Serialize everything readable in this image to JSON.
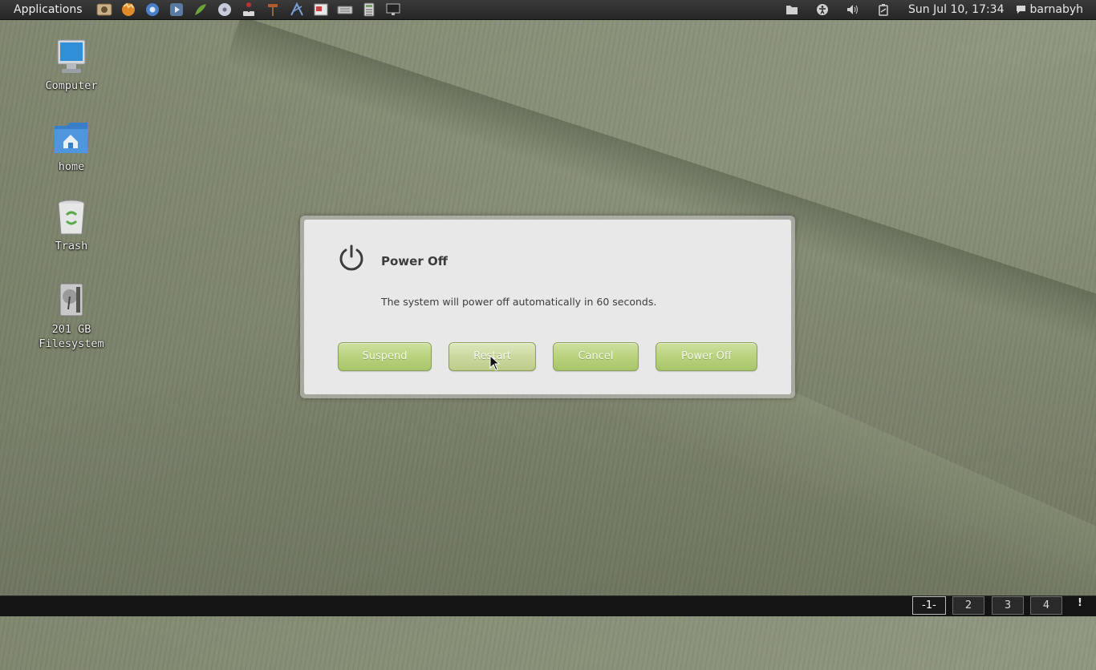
{
  "top_panel": {
    "applications_label": "Applications",
    "launchers": [
      "image-viewer-icon",
      "firefox-icon",
      "chromium-icon",
      "media-player-icon",
      "inkscape-icon",
      "disc-burner-icon",
      "joystick-icon",
      "hammer-tool-icon",
      "geogebra-icon",
      "presentation-icon",
      "keyboard-icon",
      "calculator-icon",
      "monitor-icon"
    ],
    "tray": [
      "files-icon",
      "accessibility-icon",
      "volume-icon",
      "battery-icon"
    ],
    "clock": "Sun Jul 10, 17:34",
    "user": "barnabyh"
  },
  "desktop": {
    "icons": [
      {
        "name": "computer-icon",
        "label": "Computer"
      },
      {
        "name": "home-folder-icon",
        "label": "home"
      },
      {
        "name": "trash-icon",
        "label": "Trash"
      },
      {
        "name": "drive-icon",
        "label_line1": "201 GB",
        "label_line2": "Filesystem"
      }
    ]
  },
  "dialog": {
    "title": "Power Off",
    "message": "The system will power off automatically in 60 seconds.",
    "icon": "power-icon",
    "buttons": {
      "suspend": "Suspend",
      "restart": "Restart",
      "cancel": "Cancel",
      "power_off": "Power Off"
    }
  },
  "bottom_panel": {
    "workspaces": [
      "-1-",
      "2",
      "3",
      "4"
    ],
    "active_workspace": "-1-",
    "notification": "!"
  },
  "colors": {
    "button_green": "#b9d27e",
    "dialog_bg": "#e8e8e8",
    "panel_bg": "#262626"
  }
}
